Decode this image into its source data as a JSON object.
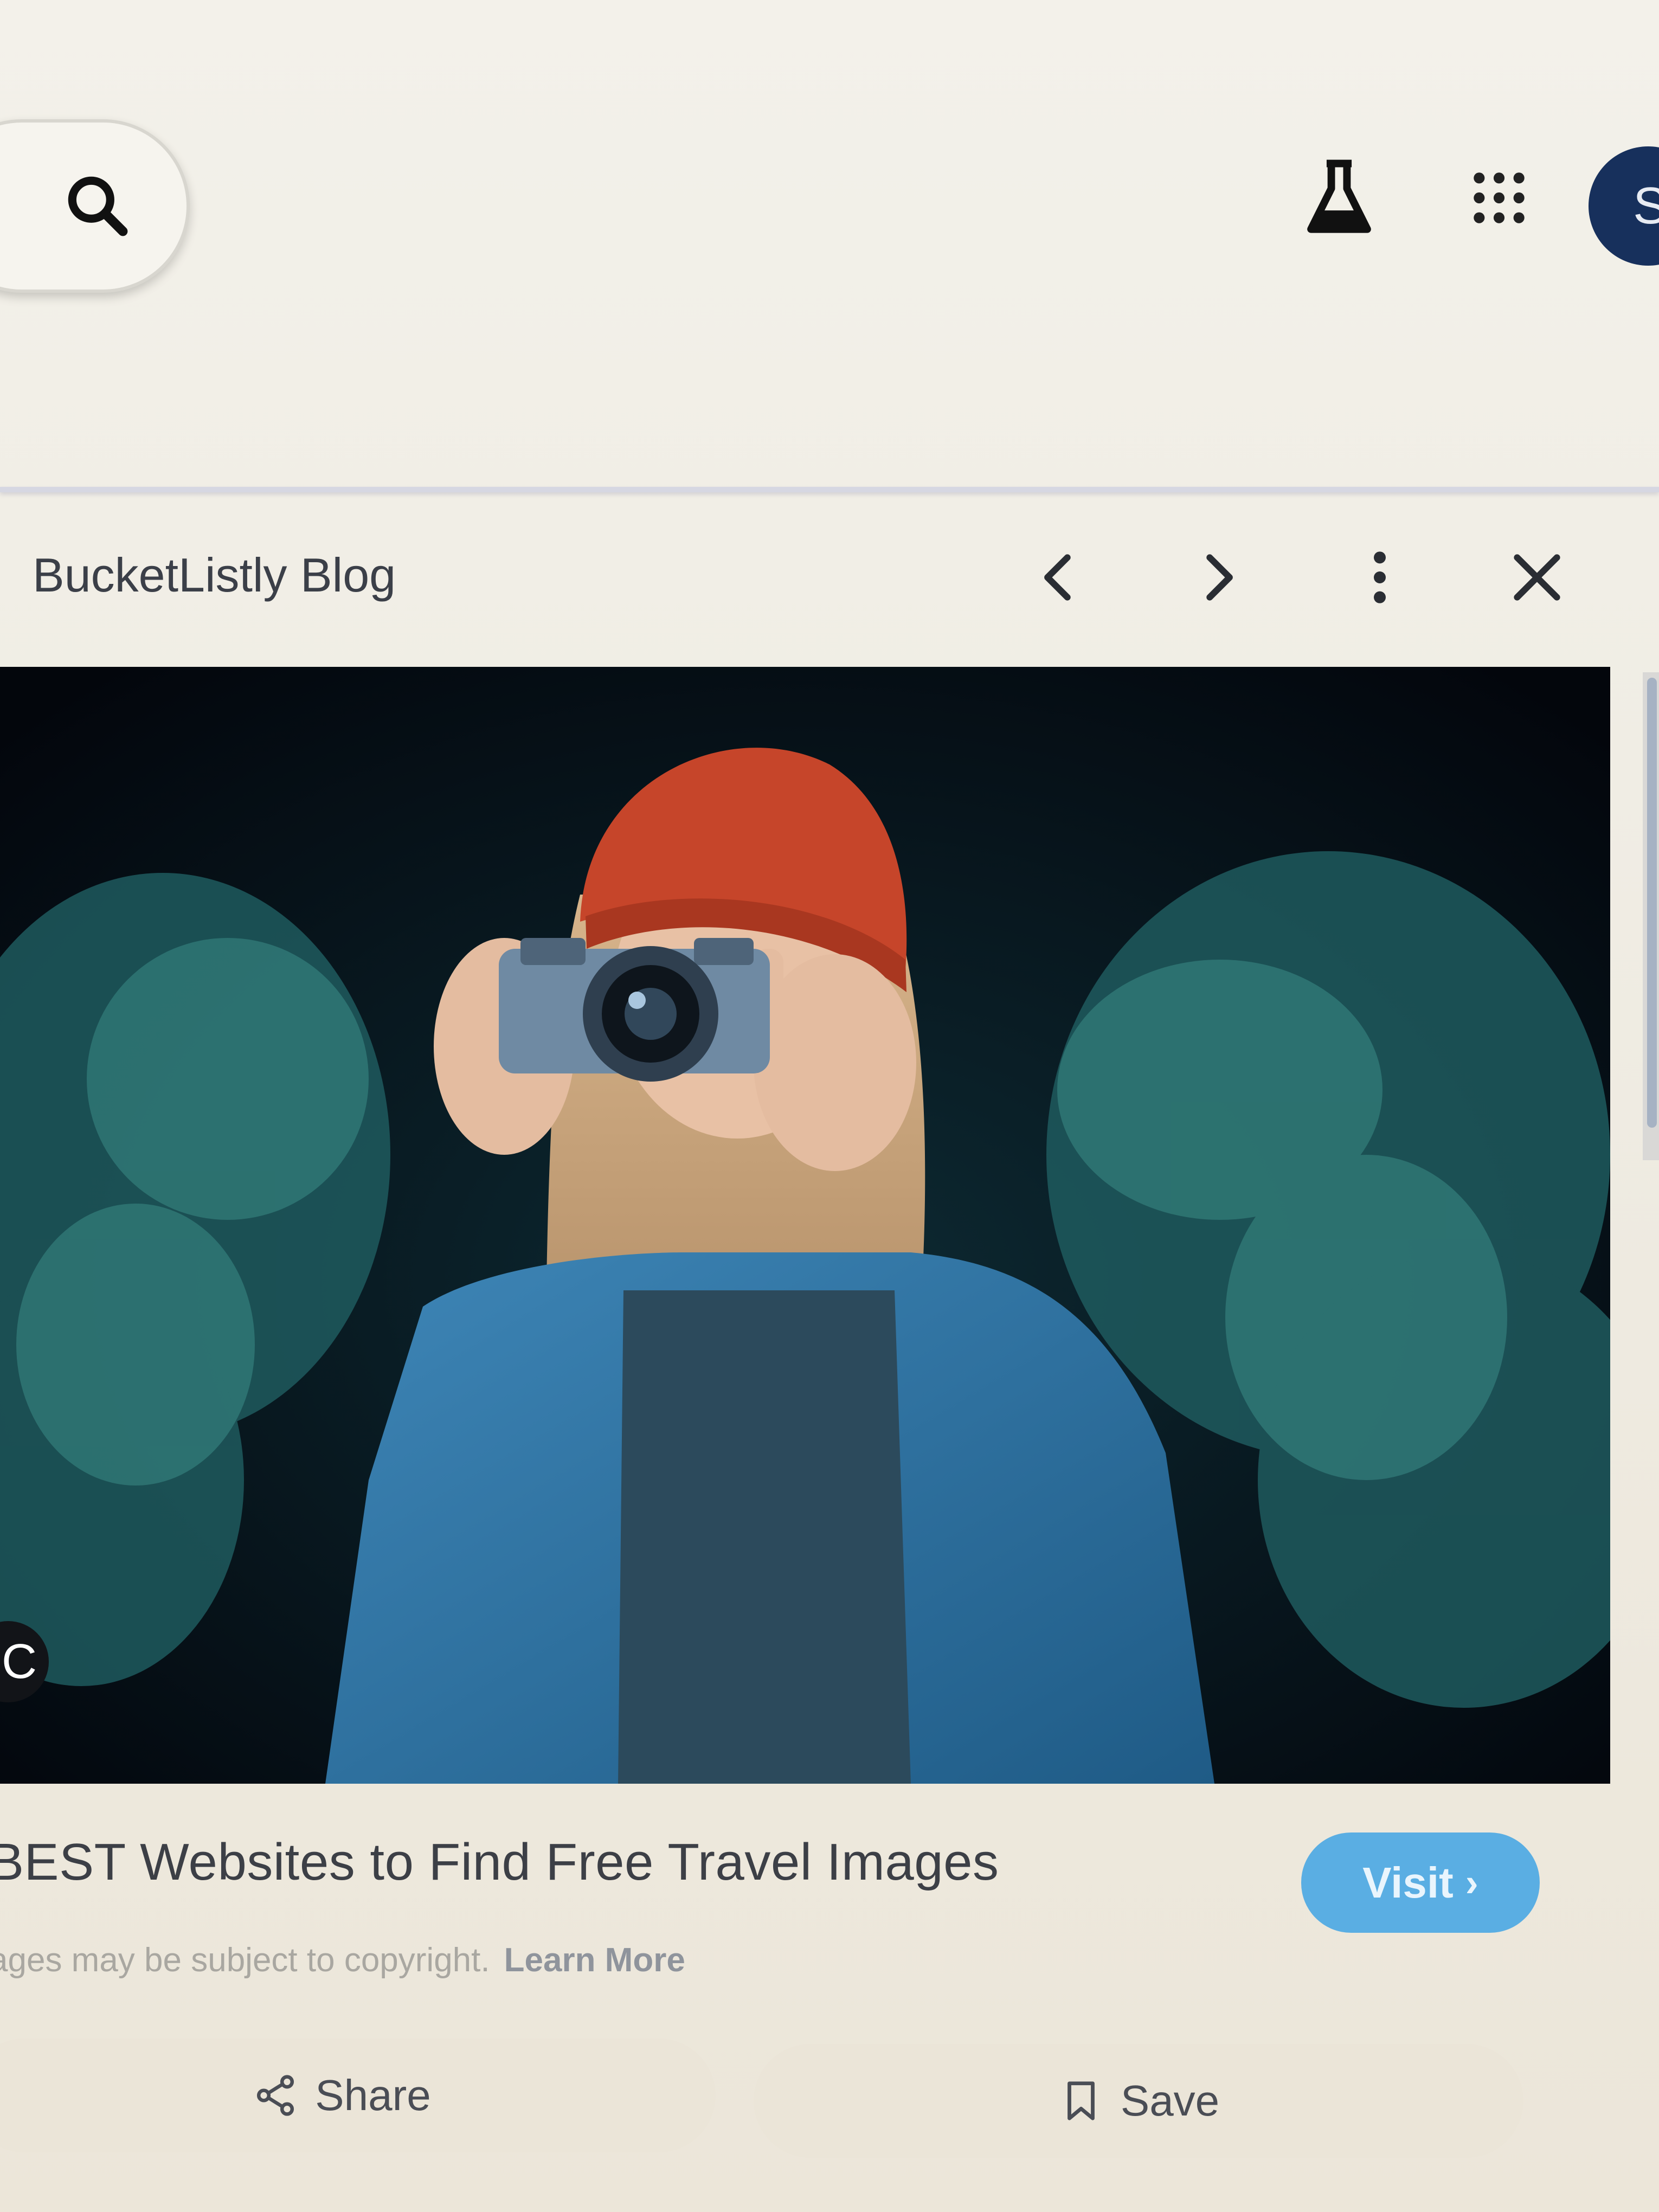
{
  "header": {
    "account_initial": "S"
  },
  "viewer": {
    "source_name": "BucketListly Blog"
  },
  "caption": {
    "title": "BEST Websites to Find Free Travel Images",
    "visit_label": "Visit",
    "visit_chevron": "›",
    "copyright_text": "ages may be subject to copyright.",
    "learn_more_label": "Learn More"
  },
  "actions": {
    "share_label": "Share",
    "save_label": "Save"
  },
  "lens_chip": {
    "glyph": "C"
  },
  "colors": {
    "accent": "#5aaee3",
    "avatar_bg": "#17305c",
    "photo_hat": "#c6452a",
    "photo_shirt": "#2f6f9f"
  },
  "icons": [
    "search-icon",
    "labs-flask-icon",
    "apps-grid-icon",
    "chevron-left-icon",
    "chevron-right-icon",
    "more-vertical-icon",
    "close-icon",
    "share-icon",
    "bookmark-icon"
  ]
}
